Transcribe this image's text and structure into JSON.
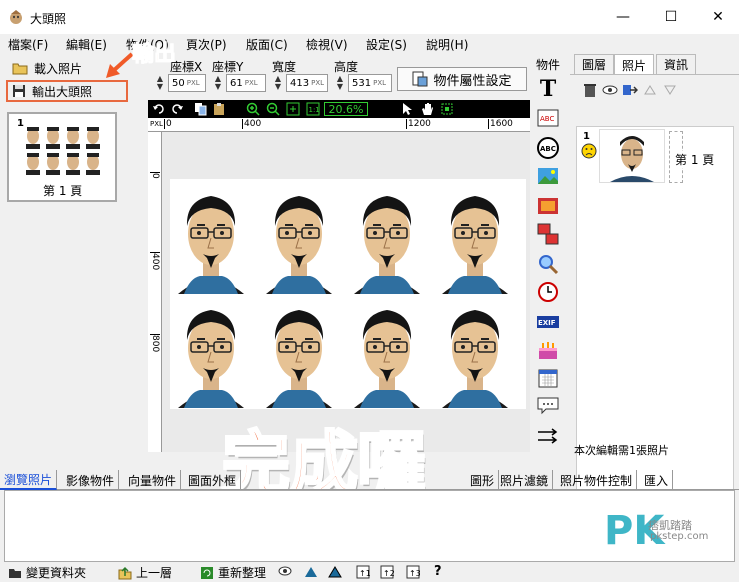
{
  "window": {
    "title": "大頭照",
    "controls": {
      "minimize": "—",
      "maximize": "☐",
      "close": "✕"
    }
  },
  "menu": [
    "檔案(F)",
    "編輯(E)",
    "物件(O)",
    "頁次(P)",
    "版面(C)",
    "檢視(V)",
    "設定(S)",
    "說明(H)"
  ],
  "left": {
    "load_label": "載入照片",
    "export_label": "輸出大頭照",
    "page_number": "1",
    "page_label": "第 1 頁"
  },
  "fields": [
    {
      "label": "座標X",
      "value": "50",
      "unit": "PXL"
    },
    {
      "label": "座標Y",
      "value": "61",
      "unit": "PXL"
    },
    {
      "label": "寬度",
      "value": "413",
      "unit": "PXL"
    },
    {
      "label": "高度",
      "value": "531",
      "unit": "PXL"
    }
  ],
  "property_button": "物件屬性設定",
  "zoom": "20.6%",
  "ruler_h": [
    "PXL",
    "0",
    "400",
    "1200",
    "1600"
  ],
  "ruler_v": [
    "0",
    "400",
    "800"
  ],
  "side_tools_label": "物件",
  "right": {
    "tabs": [
      "圖層",
      "照片",
      "資訊"
    ],
    "item_number": "1",
    "item_label": "第 1 頁",
    "status": "本次編輯需1張照片"
  },
  "bottom_tabs": [
    "瀏覽照片",
    "影像物件",
    "向量物件",
    "圖面外框",
    "圖形",
    "照片濾鏡",
    "照片物件控制",
    "匯入"
  ],
  "bottom_toolbar": [
    "變更資料夾",
    "上一層",
    "重新整理"
  ],
  "annotations": {
    "export_callout": "輸出",
    "done_text": "完成囉"
  },
  "watermark": {
    "brand": "PK",
    "name": "痞凱踏踏",
    "site": "pkstep.com"
  },
  "colors": {
    "accent_orange": "#f05a28",
    "zoom_green": "#33cc33",
    "watermark_teal": "#3fb6c7"
  }
}
